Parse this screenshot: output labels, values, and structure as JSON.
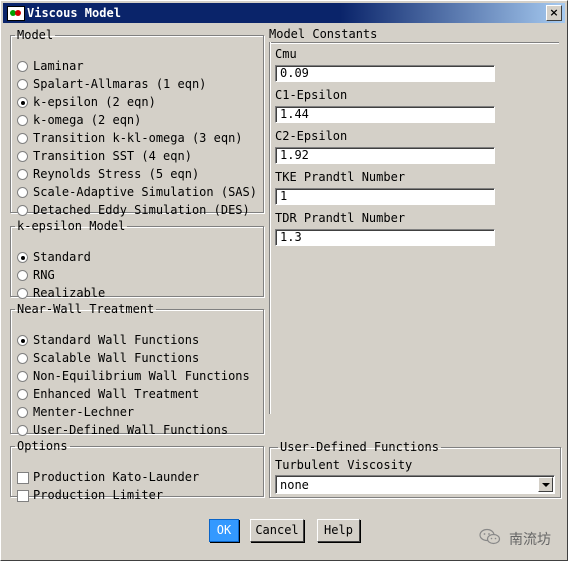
{
  "window": {
    "title": "Viscous Model"
  },
  "model": {
    "legend": "Model",
    "options": [
      {
        "label": "Laminar",
        "selected": false
      },
      {
        "label": "Spalart-Allmaras (1 eqn)",
        "selected": false
      },
      {
        "label": "k-epsilon (2 eqn)",
        "selected": true
      },
      {
        "label": "k-omega (2 eqn)",
        "selected": false
      },
      {
        "label": "Transition k-kl-omega (3 eqn)",
        "selected": false
      },
      {
        "label": "Transition SST (4 eqn)",
        "selected": false
      },
      {
        "label": "Reynolds Stress (5 eqn)",
        "selected": false
      },
      {
        "label": "Scale-Adaptive Simulation (SAS)",
        "selected": false
      },
      {
        "label": "Detached Eddy Simulation (DES)",
        "selected": false
      }
    ]
  },
  "kepsilon_model": {
    "legend": "k-epsilon Model",
    "options": [
      {
        "label": "Standard",
        "selected": true
      },
      {
        "label": "RNG",
        "selected": false
      },
      {
        "label": "Realizable",
        "selected": false
      }
    ]
  },
  "near_wall": {
    "legend": "Near-Wall Treatment",
    "options": [
      {
        "label": "Standard Wall Functions",
        "selected": true
      },
      {
        "label": "Scalable Wall Functions",
        "selected": false
      },
      {
        "label": "Non-Equilibrium Wall Functions",
        "selected": false
      },
      {
        "label": "Enhanced Wall Treatment",
        "selected": false
      },
      {
        "label": "Menter-Lechner",
        "selected": false
      },
      {
        "label": "User-Defined Wall Functions",
        "selected": false
      }
    ]
  },
  "options_group": {
    "legend": "Options",
    "checkboxes": [
      {
        "label": "Production Kato-Launder",
        "checked": false
      },
      {
        "label": "Production Limiter",
        "checked": false
      }
    ]
  },
  "model_constants": {
    "title": "Model Constants",
    "fields": [
      {
        "label": "Cmu",
        "value": "0.09"
      },
      {
        "label": "C1-Epsilon",
        "value": "1.44"
      },
      {
        "label": "C2-Epsilon",
        "value": "1.92"
      },
      {
        "label": "TKE Prandtl Number",
        "value": "1"
      },
      {
        "label": "TDR Prandtl Number",
        "value": "1.3"
      }
    ]
  },
  "udf": {
    "legend": "User-Defined Functions",
    "label": "Turbulent Viscosity",
    "value": "none"
  },
  "buttons": {
    "ok": "OK",
    "cancel": "Cancel",
    "help": "Help"
  },
  "watermark": {
    "text": "南流坊"
  }
}
